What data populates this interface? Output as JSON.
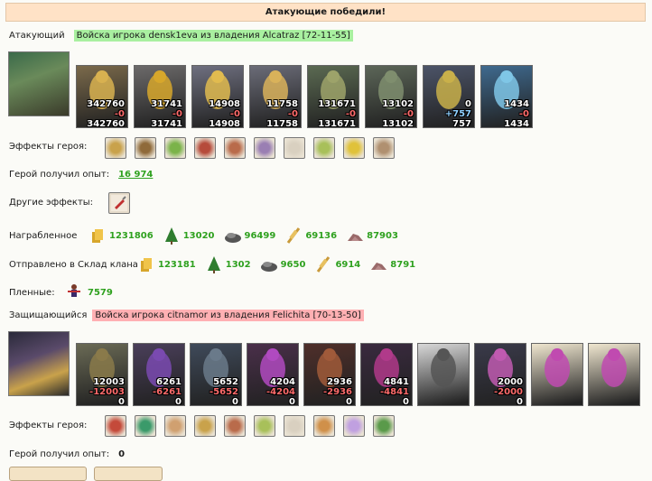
{
  "header": {
    "title": "Атакующие победили!"
  },
  "attacker": {
    "label": "Атакующий",
    "army": "Войска игрока densk1eva из владения Alcatraz [72-11-55]",
    "units": [
      {
        "a": "342760",
        "b": "-0",
        "c": "342760",
        "bg": "#7b6a4b",
        "fg": "#d8b150"
      },
      {
        "a": "31741",
        "b": "-0",
        "c": "31741",
        "bg": "#6c6a6a",
        "fg": "#d7a72b"
      },
      {
        "a": "14908",
        "b": "-0",
        "c": "14908",
        "bg": "#6f7080",
        "fg": "#e1bb4f"
      },
      {
        "a": "11758",
        "b": "-0",
        "c": "11758",
        "bg": "#6b6c78",
        "fg": "#d9b25a"
      },
      {
        "a": "131671",
        "b": "-0",
        "c": "131671",
        "bg": "#5b6a52",
        "fg": "#9da36a"
      },
      {
        "a": "13102",
        "b": "-0",
        "c": "13102",
        "bg": "#5c6658",
        "fg": "#7f8e6e"
      },
      {
        "a": "0",
        "b": "+757",
        "c": "757",
        "bg": "#4c5468",
        "fg": "#c9b04a"
      },
      {
        "a": "1434",
        "b": "-0",
        "c": "1434",
        "bg": "#3f6a8f",
        "fg": "#7fc6e6"
      }
    ],
    "effects_label": "Эффекты героя:",
    "effects": [
      "#c9a24b",
      "#8f6a3a",
      "#7bb34a",
      "#b64b3b",
      "#b96b4b",
      "#9a7fb3",
      "#d9d0c0",
      "#a8c05a",
      "#e0c23a",
      "#b09070"
    ],
    "exp_label": "Герой получил опыт:",
    "exp": "16 974",
    "other_label": "Другие эффекты:",
    "loot_label": "Награбленное",
    "loot": [
      "1231806",
      "13020",
      "96499",
      "69136",
      "87903"
    ],
    "clan_label": "Отправлено в Склад клана",
    "clan": [
      "123181",
      "1302",
      "9650",
      "6914",
      "8791"
    ],
    "prisoners_label": "Пленные:",
    "prisoners": "7579"
  },
  "defender": {
    "label": "Защищающийся",
    "army": "Войска игрока citnamor из владения Felichita [70-13-50]",
    "units": [
      {
        "a": "12003",
        "b": "-12003",
        "c": "0",
        "bg": "#6a6a55",
        "fg": "#8a7a4a"
      },
      {
        "a": "6261",
        "b": "-6261",
        "c": "0",
        "bg": "#4a3f5a",
        "fg": "#7a4ab0"
      },
      {
        "a": "5652",
        "b": "-5652",
        "c": "0",
        "bg": "#3f4a5a",
        "fg": "#6a7a8a"
      },
      {
        "a": "4204",
        "b": "-4204",
        "c": "0",
        "bg": "#4a2f4a",
        "fg": "#b04ac0"
      },
      {
        "a": "2936",
        "b": "-2936",
        "c": "0",
        "bg": "#4f2f2a",
        "fg": "#a05a3a"
      },
      {
        "a": "4841",
        "b": "-4841",
        "c": "0",
        "bg": "#3a2a3f",
        "fg": "#b03a8a"
      },
      {
        "a": "",
        "b": "",
        "c": "",
        "bg": "#d8d8d8",
        "fg": "#555555"
      },
      {
        "a": "2000",
        "b": "-2000",
        "c": "0",
        "bg": "#3a3a4a",
        "fg": "#c05ab0"
      },
      {
        "a": "",
        "b": "",
        "c": "",
        "bg": "#efe6cf",
        "fg": "#c04ab0"
      },
      {
        "a": "",
        "b": "",
        "c": "",
        "bg": "#efe6cf",
        "fg": "#c04ab0"
      }
    ],
    "effects_label": "Эффекты героя:",
    "effects": [
      "#c44a3a",
      "#3a9a6a",
      "#d0a070",
      "#c9a24b",
      "#b96b4b",
      "#a8c05a",
      "#d9d0c0",
      "#d0904a",
      "#c0a0e0",
      "#5a9a4a"
    ],
    "exp_label": "Герой получил опыт:",
    "exp": "0"
  },
  "resource_icons": [
    "gold-icon",
    "wood-icon",
    "ore-icon",
    "grain-icon",
    "stone-icon"
  ]
}
